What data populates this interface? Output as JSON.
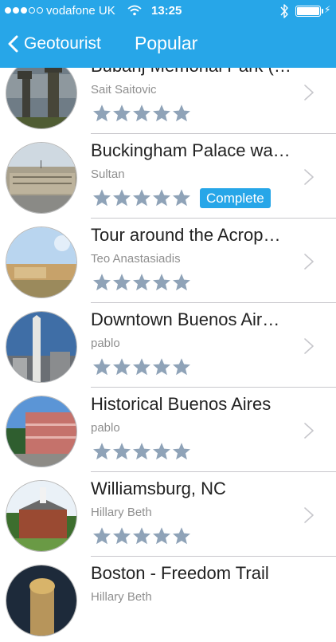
{
  "status_bar": {
    "carrier": "vodafone UK",
    "time": "13:25"
  },
  "nav": {
    "back_label": "Geotourist",
    "title": "Popular"
  },
  "colors": {
    "accent": "#27a6e8",
    "star": "#8fa3b8"
  },
  "tours": [
    {
      "title": "Bubanj Memorial Park (…",
      "author": "Sait Saitovic",
      "rating": 5
    },
    {
      "title": "Buckingham Palace wa…",
      "author": "Sultan",
      "rating": 5,
      "badge": "Complete"
    },
    {
      "title": "Tour around the Acrop…",
      "author": "Teo Anastasiadis",
      "rating": 5
    },
    {
      "title": "Downtown Buenos Air…",
      "author": "pablo",
      "rating": 5
    },
    {
      "title": "Historical Buenos Aires",
      "author": "pablo",
      "rating": 5
    },
    {
      "title": "Williamsburg, NC",
      "author": "Hillary Beth",
      "rating": 5
    },
    {
      "title": "Boston - Freedom Trail",
      "author": "Hillary Beth",
      "rating": 5
    }
  ]
}
